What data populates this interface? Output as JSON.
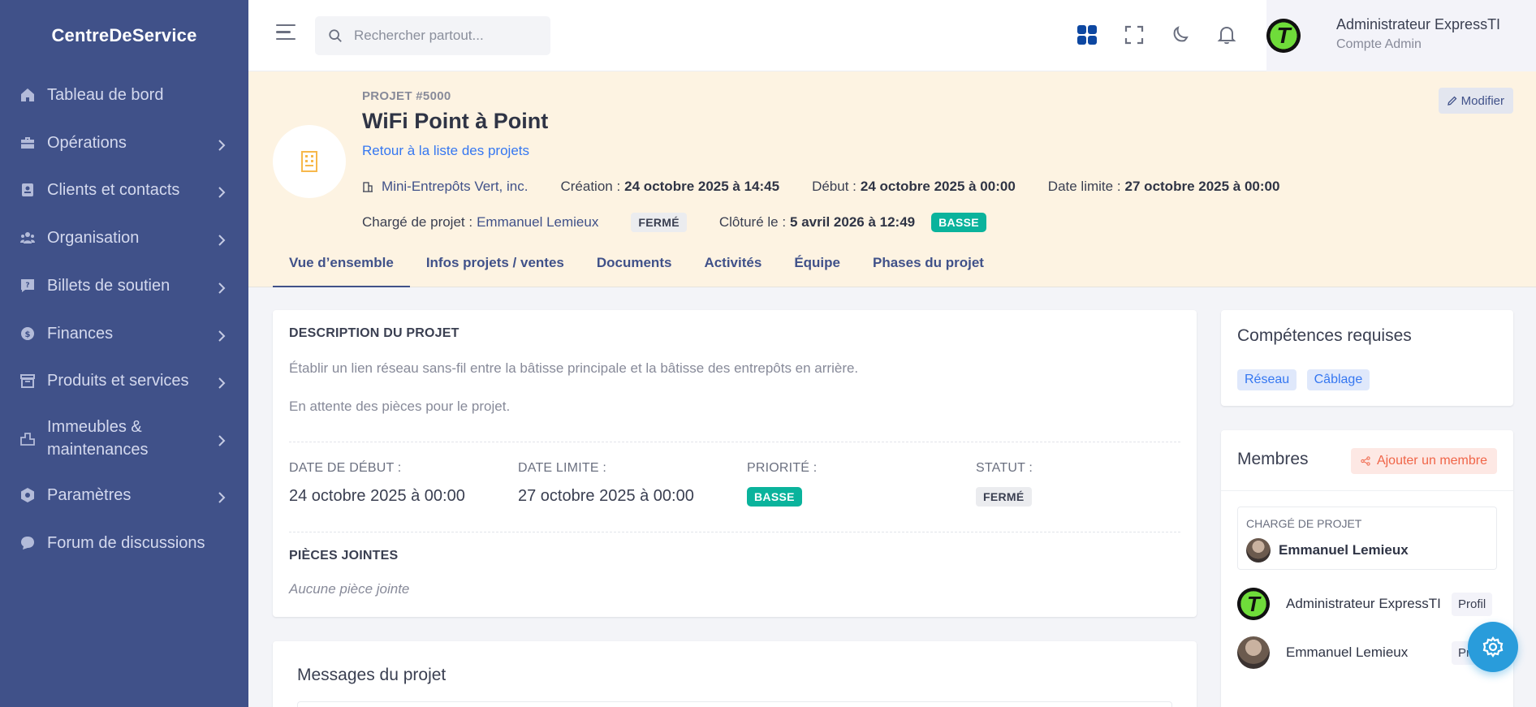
{
  "app": {
    "brand": "CentreDeService"
  },
  "sidebar": {
    "items": [
      {
        "label": "Tableau de bord",
        "icon": "home-icon",
        "chevron": false
      },
      {
        "label": "Opérations",
        "icon": "briefcase-icon",
        "chevron": true
      },
      {
        "label": "Clients et contacts",
        "icon": "contact-card-icon",
        "chevron": true
      },
      {
        "label": "Organisation",
        "icon": "team-icon",
        "chevron": true
      },
      {
        "label": "Billets de soutien",
        "icon": "ticket-icon",
        "chevron": true
      },
      {
        "label": "Finances",
        "icon": "money-icon",
        "chevron": true
      },
      {
        "label": "Produits et services",
        "icon": "archive-icon",
        "chevron": true
      },
      {
        "label_line1": "Immeubles &",
        "label_line2": "maintenances",
        "icon": "building-icon",
        "chevron": true
      },
      {
        "label": "Paramètres",
        "icon": "settings-hex-icon",
        "chevron": true
      },
      {
        "label": "Forum de discussions",
        "icon": "chat-icon",
        "chevron": false
      }
    ]
  },
  "topbar": {
    "search_placeholder": "Rechercher partout...",
    "user": {
      "name": "Administrateur ExpressTI",
      "role": "Compte Admin"
    }
  },
  "project": {
    "number": "PROJET #5000",
    "title": "WiFi Point à Point",
    "back_link": "Retour à la liste des projets",
    "edit_label": "Modifier",
    "client": "Mini-Entrepôts Vert, inc.",
    "creation_label": "Création :",
    "creation_value": "24 octobre 2025 à 14:45",
    "start_label": "Début :",
    "start_value": "24 octobre 2025 à 00:00",
    "deadline_label": "Date limite :",
    "deadline_value": "27 octobre 2025 à 00:00",
    "manager_label": "Chargé de projet :",
    "manager_value": "Emmanuel Lemieux",
    "status_badge": "FERMÉ",
    "closed_label": "Clôturé le :",
    "closed_value": "5 avril 2026 à 12:49",
    "priority_badge": "BASSE"
  },
  "tabs": [
    "Vue d’ensemble",
    "Infos projets / ventes",
    "Documents",
    "Activités",
    "Équipe",
    "Phases du projet"
  ],
  "description": {
    "title": "DESCRIPTION DU PROJET",
    "line1": "Établir un lien réseau sans-fil entre la bâtisse principale et la bâtisse des entrepôts en arrière.",
    "line2": "En attente des pièces pour le projet.",
    "start_label": "DATE DE DÉBUT :",
    "start_value": "24 octobre 2025 à 00:00",
    "deadline_label": "DATE LIMITE :",
    "deadline_value": "27 octobre 2025 à 00:00",
    "priority_label": "PRIORITÉ :",
    "priority_value": "BASSE",
    "status_label": "STATUT :",
    "status_value": "FERMÉ",
    "attachments_title": "PIÈCES JOINTES",
    "attachments_empty": "Aucune pièce jointe"
  },
  "messages": {
    "title": "Messages du projet"
  },
  "skills": {
    "title": "Compétences requises",
    "items": [
      "Réseau",
      "Câblage"
    ]
  },
  "members": {
    "title": "Membres",
    "add_label": "Ajouter un membre",
    "manager_caption": "CHARGÉ DE PROJET",
    "manager_name": "Emmanuel Lemieux",
    "list": [
      {
        "name": "Administrateur ExpressTI",
        "action": "Profil"
      },
      {
        "name": "Emmanuel Lemieux",
        "action": "Pr"
      }
    ]
  },
  "colors": {
    "sidebar": "#405189",
    "header_bg": "#fdf3e2",
    "success": "#0ab39c",
    "link": "#3577f1",
    "danger": "#f06548",
    "fab": "#299cdb"
  }
}
